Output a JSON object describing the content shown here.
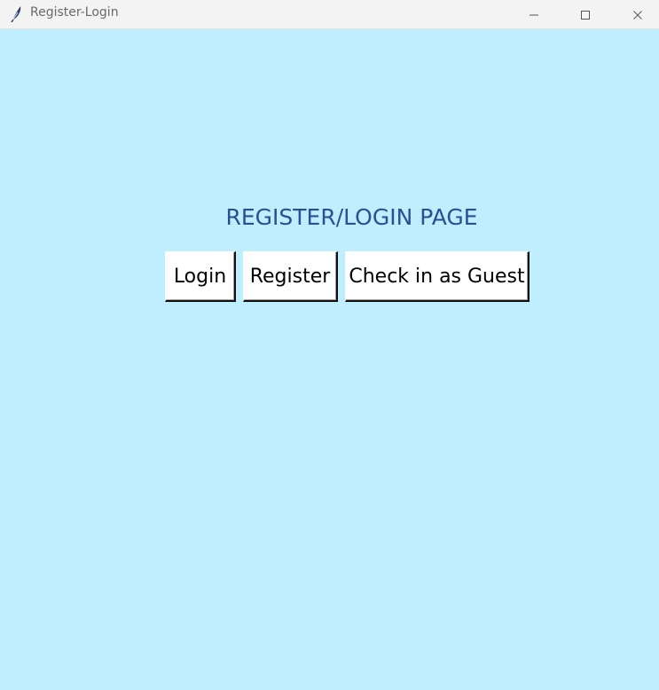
{
  "window": {
    "title": "Register-Login",
    "background": "#bfeefe",
    "titlebar_color": "#f3f3f3",
    "controls": {
      "minimize_icon": "minimize-icon",
      "maximize_icon": "maximize-icon",
      "close_icon": "close-icon"
    }
  },
  "page": {
    "heading": "REGISTER/LOGIN PAGE",
    "heading_color": "#2a4f96",
    "buttons": {
      "login": "Login",
      "register": "Register",
      "guest": "Check in as Guest"
    }
  }
}
